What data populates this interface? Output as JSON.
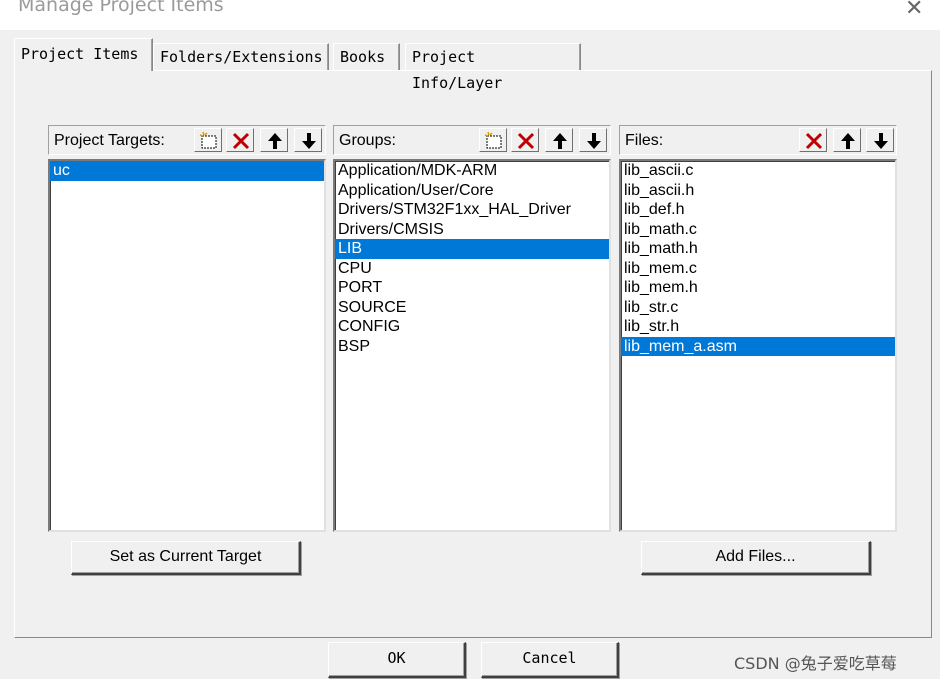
{
  "window": {
    "title": "Manage Project Items"
  },
  "tabs": [
    {
      "label": "Project Items",
      "active": true
    },
    {
      "label": "Folders/Extensions"
    },
    {
      "label": "Books"
    },
    {
      "label": "Project Info/Layer"
    }
  ],
  "targets": {
    "label": "Project Targets:",
    "items": [
      "uc"
    ],
    "selected": "uc"
  },
  "groups": {
    "label": "Groups:",
    "items": [
      "Application/MDK-ARM",
      "Application/User/Core",
      "Drivers/STM32F1xx_HAL_Driver",
      "Drivers/CMSIS",
      "LIB",
      "CPU",
      "PORT",
      "SOURCE",
      "CONFIG",
      "BSP"
    ],
    "selected": "LIB"
  },
  "files": {
    "label": "Files:",
    "items": [
      "lib_ascii.c",
      "lib_ascii.h",
      "lib_def.h",
      "lib_math.c",
      "lib_math.h",
      "lib_mem.c",
      "lib_mem.h",
      "lib_str.c",
      "lib_str.h",
      "lib_mem_a.asm"
    ],
    "selected": "lib_mem_a.asm"
  },
  "buttons": {
    "set_current": "Set as Current Target",
    "add_files": "Add Files...",
    "ok": "OK",
    "cancel": "Cancel"
  },
  "watermark": "CSDN @兔子爱吃草莓",
  "colors": {
    "selection": "#0078d7",
    "delete_icon": "#c00000"
  },
  "icons": {
    "new": "new-item-icon",
    "delete": "delete-icon",
    "up": "move-up-icon",
    "down": "move-down-icon"
  }
}
